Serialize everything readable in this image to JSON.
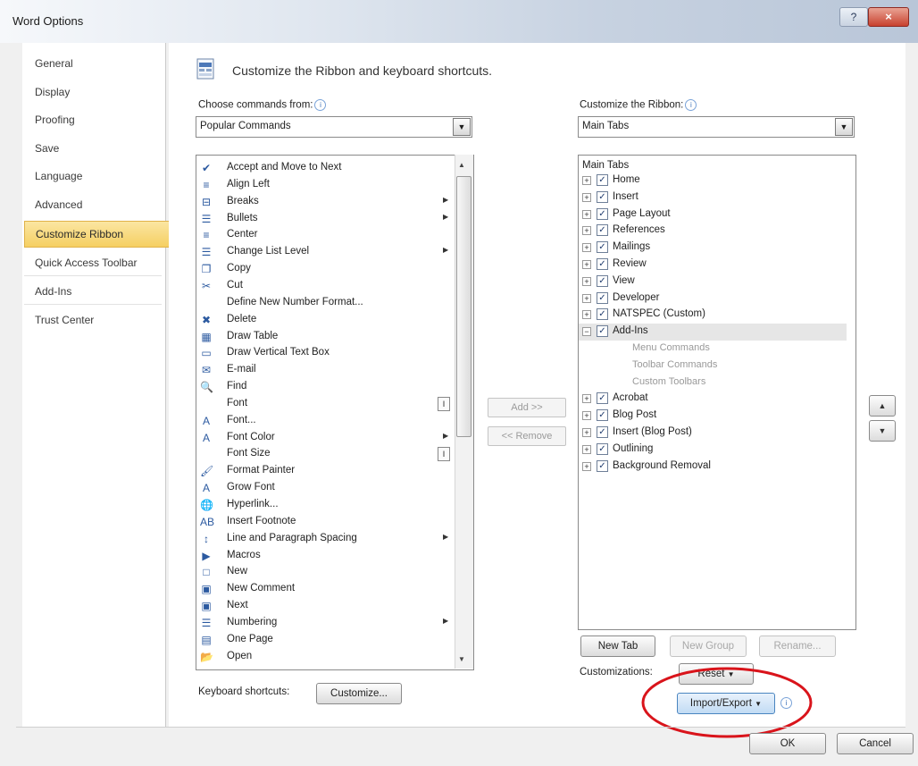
{
  "window": {
    "title": "Word Options",
    "help_label": "?",
    "close_label": "×"
  },
  "nav": {
    "items": [
      {
        "label": "General"
      },
      {
        "label": "Display"
      },
      {
        "label": "Proofing"
      },
      {
        "label": "Save"
      },
      {
        "label": "Language"
      },
      {
        "label": "Advanced"
      },
      {
        "label": "Customize Ribbon",
        "selected": true
      },
      {
        "label": "Quick Access Toolbar"
      },
      {
        "label": "Add-Ins"
      },
      {
        "label": "Trust Center"
      }
    ]
  },
  "header": {
    "text": "Customize the Ribbon and keyboard shortcuts."
  },
  "left": {
    "label": "Choose commands from:",
    "label_hotkey": "C",
    "combo_value": "Popular Commands",
    "commands": [
      {
        "label": "Accept and Move to Next",
        "icon": "✔"
      },
      {
        "label": "Align Left",
        "icon": "≡"
      },
      {
        "label": "Breaks",
        "icon": "⊟",
        "submenu": true
      },
      {
        "label": "Bullets",
        "icon": "☰",
        "submenu": true
      },
      {
        "label": "Center",
        "icon": "≡"
      },
      {
        "label": "Change List Level",
        "icon": "☰",
        "submenu": true
      },
      {
        "label": "Copy",
        "icon": "❐"
      },
      {
        "label": "Cut",
        "icon": "✂"
      },
      {
        "label": "Define New Number Format...",
        "icon": ""
      },
      {
        "label": "Delete",
        "icon": "✖"
      },
      {
        "label": "Draw Table",
        "icon": "▦"
      },
      {
        "label": "Draw Vertical Text Box",
        "icon": "▭"
      },
      {
        "label": "E-mail",
        "icon": "✉"
      },
      {
        "label": "Find",
        "icon": "🔍"
      },
      {
        "label": "Font",
        "icon": "",
        "box": "I"
      },
      {
        "label": "Font...",
        "icon": "A"
      },
      {
        "label": "Font Color",
        "icon": "A",
        "submenu": true
      },
      {
        "label": "Font Size",
        "icon": "",
        "box": "I"
      },
      {
        "label": "Format Painter",
        "icon": "🖌"
      },
      {
        "label": "Grow Font",
        "icon": "A"
      },
      {
        "label": "Hyperlink...",
        "icon": "🌐"
      },
      {
        "label": "Insert Footnote",
        "icon": "AB"
      },
      {
        "label": "Line and Paragraph Spacing",
        "icon": "↕",
        "submenu": true
      },
      {
        "label": "Macros",
        "icon": "▶"
      },
      {
        "label": "New",
        "icon": "□"
      },
      {
        "label": "New Comment",
        "icon": "▣"
      },
      {
        "label": "Next",
        "icon": "▣"
      },
      {
        "label": "Numbering",
        "icon": "☰",
        "submenu": true
      },
      {
        "label": "One Page",
        "icon": "▤"
      },
      {
        "label": "Open",
        "icon": "📂"
      }
    ]
  },
  "middle": {
    "add_label": "Add >>",
    "remove_label": "<< Remove"
  },
  "right": {
    "label": "Customize the Ribbon:",
    "combo_value": "Main Tabs",
    "tree_header": "Main Tabs",
    "tabs": [
      {
        "label": "Home",
        "expanded": false
      },
      {
        "label": "Insert",
        "expanded": false
      },
      {
        "label": "Page Layout",
        "expanded": false
      },
      {
        "label": "References",
        "expanded": false
      },
      {
        "label": "Mailings",
        "expanded": false
      },
      {
        "label": "Review",
        "expanded": false
      },
      {
        "label": "View",
        "expanded": false
      },
      {
        "label": "Developer",
        "expanded": false
      },
      {
        "label": "NATSPEC (Custom)",
        "expanded": false
      },
      {
        "label": "Add-Ins",
        "expanded": true,
        "selected": true,
        "children": [
          "Menu Commands",
          "Toolbar Commands",
          "Custom Toolbars"
        ]
      },
      {
        "label": "Acrobat",
        "expanded": false
      },
      {
        "label": "Blog Post",
        "expanded": false
      },
      {
        "label": "Insert (Blog Post)",
        "expanded": false
      },
      {
        "label": "Outlining",
        "expanded": false
      },
      {
        "label": "Background Removal",
        "expanded": false
      }
    ],
    "new_tab_label": "New Tab",
    "new_group_label": "New Group",
    "rename_label": "Rename...",
    "customizations_label": "Customizations:",
    "reset_label": "Reset",
    "import_export_label": "Import/Export"
  },
  "keyboard": {
    "label": "Keyboard shortcuts:",
    "button_label": "Customize..."
  },
  "footer": {
    "ok_label": "OK",
    "cancel_label": "Cancel"
  },
  "annotation_color": "#d9141b"
}
